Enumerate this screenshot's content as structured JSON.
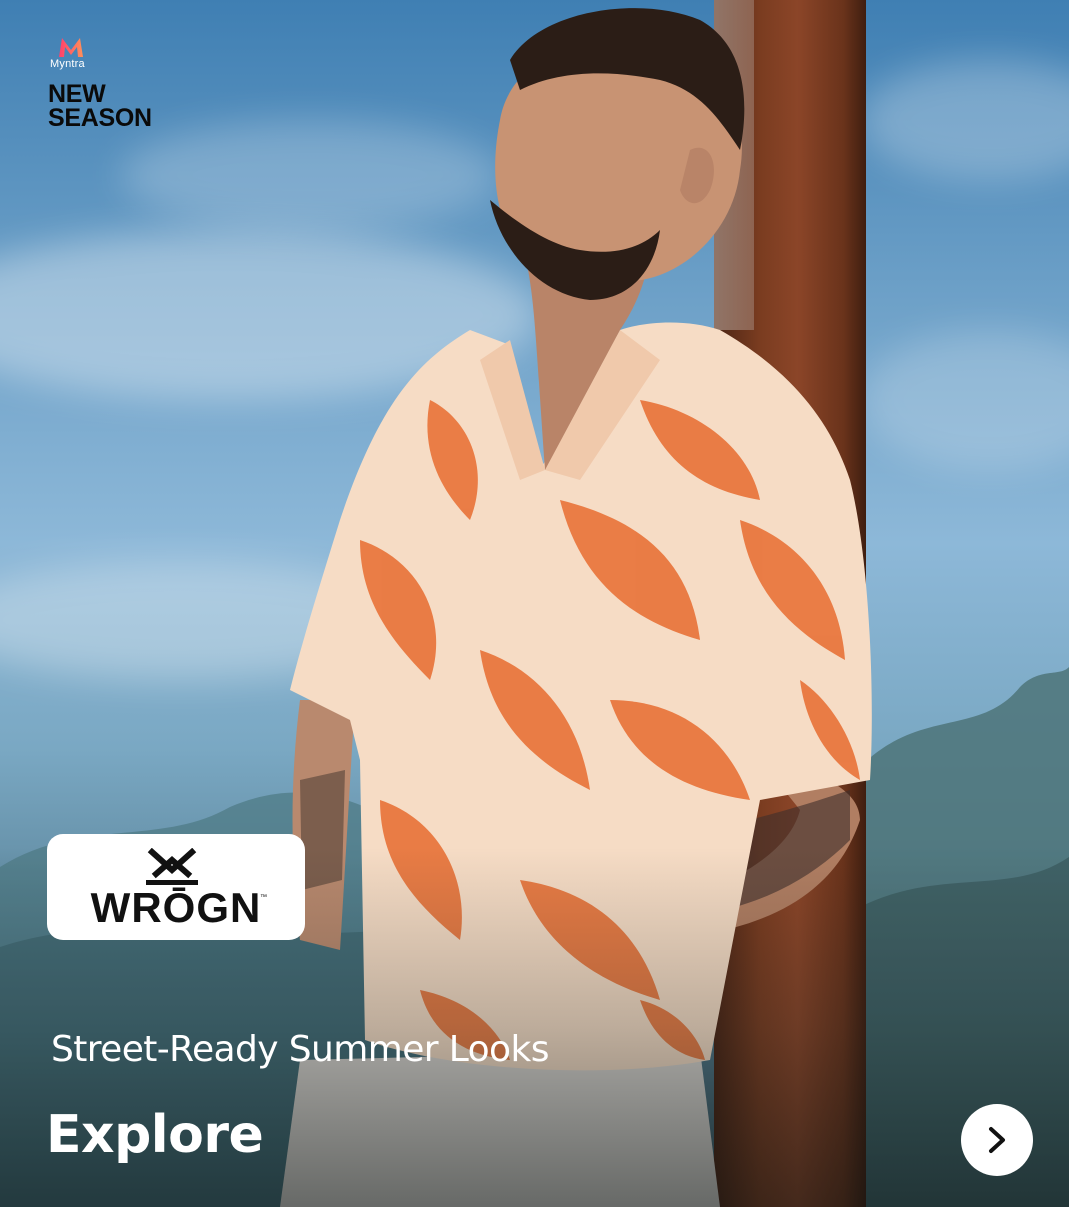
{
  "brand": {
    "logo_icon": "myntra-m-logo",
    "name": "Myntra",
    "season_line1": "NEW",
    "season_line2": "SEASON"
  },
  "banner": {
    "partner_brand": "WRŌGN",
    "partner_logo_icon": "wrogn-crossed-logo",
    "tagline": "Street-Ready Summer Looks",
    "cta_label": "Explore",
    "next_icon": "chevron-right-icon"
  },
  "colors": {
    "shirt_orange": "#e8743b",
    "shirt_cream": "#f6dcc5",
    "post_brown": "#7a3c20",
    "sky_blue": "#6ea1c8"
  }
}
